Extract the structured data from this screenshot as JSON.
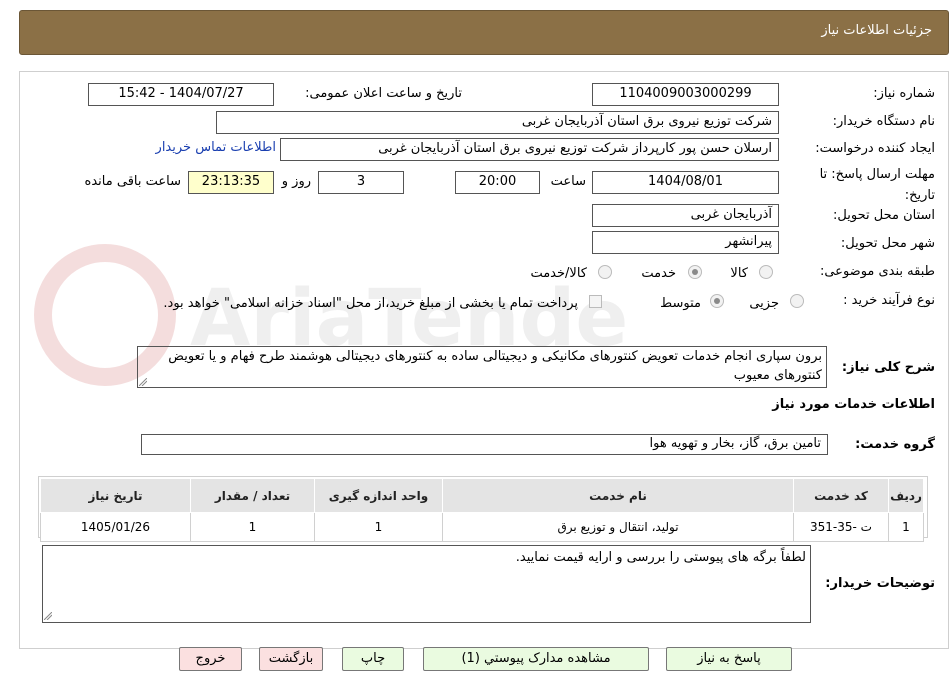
{
  "header": {
    "title": "جزئیات اطلاعات نیاز"
  },
  "watermark": {
    "text": "AriaTender.neT"
  },
  "form": {
    "need_number_label": "شماره نیاز:",
    "need_number": "1104009003000299",
    "announce_label": "تاریخ و ساعت اعلان عمومی:",
    "announce_value": "1404/07/27 - 15:42",
    "buyer_org_label": "نام دستگاه خریدار:",
    "buyer_org": "شرکت توزیع نیروی برق استان آذربایجان غربی",
    "creator_label": "ایجاد کننده درخواست:",
    "creator": "ارسلان حسن پور کارپرداز شرکت توزیع نیروی برق استان آذربایجان غربی",
    "contact_link": "اطلاعات تماس خریدار",
    "deadline_label": "مهلت ارسال پاسخ: تا تاریخ:",
    "deadline_date": "1404/08/01",
    "time_label": "ساعت",
    "deadline_time": "20:00",
    "days_value": "3",
    "days_label": "روز و",
    "remaining_time": "23:13:35",
    "remaining_label": "ساعت باقی مانده",
    "province_label": "استان محل تحویل:",
    "province": "آذربایجان غربی",
    "city_label": "شهر محل تحویل:",
    "city": "پیرانشهر",
    "category_label": "طبقه بندی موضوعی:",
    "category_options": [
      "کالا",
      "خدمت",
      "کالا/خدمت"
    ],
    "category_selected": "خدمت",
    "process_label": "نوع فرآیند خرید :",
    "process_options": [
      "جزیی",
      "متوسط"
    ],
    "process_selected": "متوسط",
    "payment_note": "پرداخت تمام یا بخشی از مبلغ خرید،از محل \"اسناد خزانه اسلامی\" خواهد بود.",
    "summary_label": "شرح کلی نیاز:",
    "summary": "برون سپاری انجام خدمات تعویض کنتورهای مکانیکی و دیجیتالی ساده به کنتورهای  دیجیتالی هوشمند طرح فهام و یا تعویض کنتورهای معیوب"
  },
  "services": {
    "section_title": "اطلاعات خدمات مورد نیاز",
    "group_label": "گروه خدمت:",
    "group_value": "تامین برق، گاز، بخار و تهویه هوا",
    "columns": [
      "ردیف",
      "کد خدمت",
      "نام خدمت",
      "واحد اندازه گیری",
      "تعداد / مقدار",
      "تاریخ نیاز"
    ],
    "rows": [
      [
        "1",
        "ت -35-351",
        "تولید، انتقال و توزیع برق",
        "1",
        "1",
        "1405/01/26"
      ]
    ]
  },
  "buyer_notes": {
    "label": "توضیحات خریدار:",
    "text": "لطفاً برگه های پیوستی را بررسی و ارایه قیمت نمایید."
  },
  "buttons": {
    "reply": "پاسخ به نیاز",
    "attachments": "مشاهده مدارک پیوستي (1)",
    "print": "چاپ",
    "back": "بازگشت",
    "exit": "خروج"
  }
}
